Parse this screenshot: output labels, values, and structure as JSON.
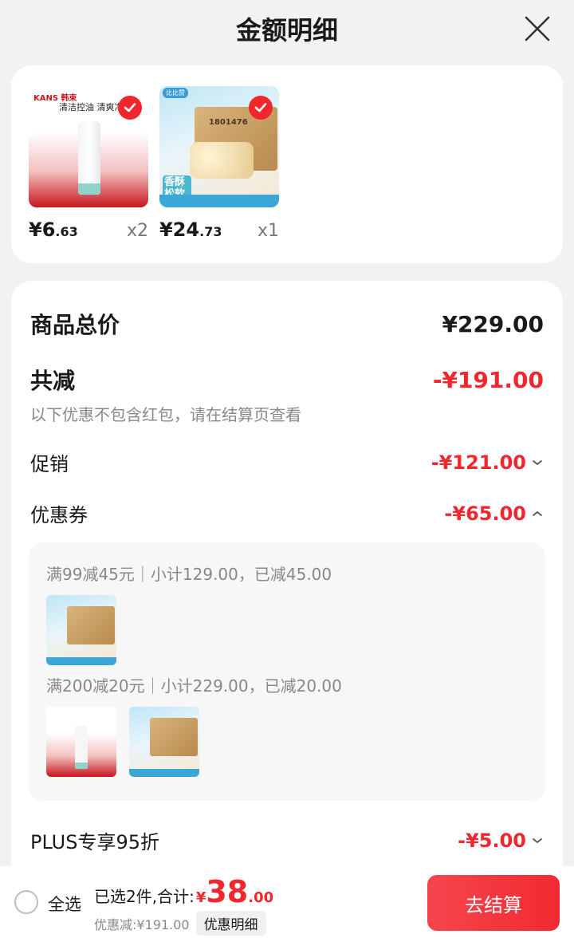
{
  "header": {
    "title": "金额明细"
  },
  "products": [
    {
      "brand": "KANS 韩束",
      "headline": "清洁控油 清爽净颜",
      "price_int": "¥6",
      "price_dec": ".63",
      "qty": "x2",
      "selected": true
    },
    {
      "brand": "比比赞",
      "code": "1801476",
      "tag": "香酥松软",
      "price_int": "¥24",
      "price_dec": ".73",
      "qty": "x1",
      "selected": true
    }
  ],
  "summary": {
    "total_label": "商品总价",
    "total_value": "¥229.00",
    "reduce_label": "共减",
    "reduce_value": "-¥191.00",
    "note": "以下优惠不包含红包，请在结算页查看",
    "promo_label": "促销",
    "promo_value": "-¥121.00",
    "coupon_label": "优惠券",
    "coupon_value": "-¥65.00",
    "coupon_lines": [
      "满99减45元｜小计129.00，已减45.00",
      "满200减20元｜小计229.00，已减20.00"
    ],
    "plus_label": "PLUS专享95折",
    "plus_value": "-¥5.00"
  },
  "bottom": {
    "select_all": "全选",
    "selected_text": "已选2件,合计:",
    "currency": "¥",
    "total_int": "38",
    "total_dec": ".00",
    "discount_text": "优惠减:¥191.00",
    "detail_button": "优惠明细",
    "checkout": "去结算"
  },
  "colors": {
    "accent": "#f0272c",
    "background": "#f2f2f2"
  },
  "icons": [
    "close-icon",
    "check-icon",
    "chevron-down-icon",
    "chevron-up-icon",
    "radio-icon"
  ]
}
